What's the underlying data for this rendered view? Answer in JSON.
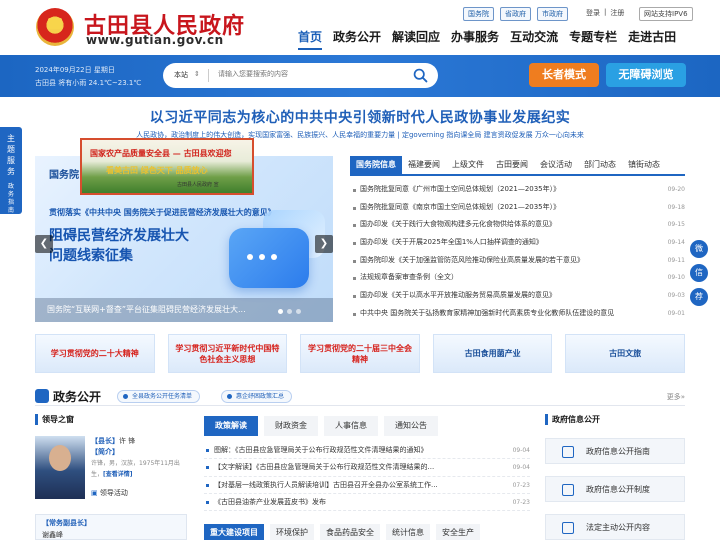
{
  "header": {
    "site_name": "古田县人民政府",
    "site_url": "www.gutian.gov.cn",
    "top_links": [
      "国务院",
      "省政府",
      "市政府"
    ],
    "login": "登录",
    "divider": "|",
    "register": "注册",
    "ipv6": "网站支持IPV6",
    "nav": [
      "首页",
      "政务公开",
      "解读回应",
      "办事服务",
      "互动交流",
      "专题专栏",
      "走进古田"
    ]
  },
  "band": {
    "date": "2024年09月22日 星期日",
    "weather": "古田县 将有小雨 24.1℃~23.1℃",
    "search_scope": "本站",
    "search_placeholder": "请输入您要搜索的内容",
    "elder_mode": "长者模式",
    "accessible": "无障碍浏览"
  },
  "side_float": {
    "label": "主题服务",
    "guide": "政务指南"
  },
  "slogan": {
    "title": "以习近平同志为核心的中共中央引领新时代人民政协事业发展纪实",
    "sub": "人民政协，政治制度上的伟大创造，实现国家富强、民族振兴、人民幸福的重要力量 | 定governing 指向课全局 建言资政促发展 万众一心向未来"
  },
  "promo": {
    "title": "国家农产品质量安全县 — 古田县欢迎您",
    "sub": "看美古田 绿色天下 品质放心",
    "foot": "古田县人民政府 宣"
  },
  "carousel": {
    "line1": "国务院",
    "line2": "贯彻落实《中共中央 国务院关于促进民营经济发展壮大的意见》",
    "line3a": "阻碍民营经济发展壮大",
    "line3b": "问题线索征集",
    "caption": "国务院“互联网+督查”平台征集阻碍民营经济发展壮大..."
  },
  "news": {
    "tabs": [
      "国务院信息",
      "福建要闻",
      "上级文件",
      "古田要闻",
      "会议活动",
      "部门动态",
      "镇街动态"
    ],
    "items": [
      {
        "title": "国务院批复同意《广州市国土空间总体规划（2021—2035年）》",
        "date": "09-20"
      },
      {
        "title": "国务院批复同意《南京市国土空间总体规划（2021—2035年）》",
        "date": "09-18"
      },
      {
        "title": "国办印发《关于践行大食物观构建多元化食物供给体系的意见》",
        "date": "09-15"
      },
      {
        "title": "国办印发《关于开展2025年全国1%人口抽样调查的通知》",
        "date": "09-14"
      },
      {
        "title": "国务院印发《关于加强监管防范风险推动保险业高质量发展的若干意见》",
        "date": "09-11"
      },
      {
        "title": "法规规章备案审查条例（全文）",
        "date": "09-10"
      },
      {
        "title": "国办印发《关于以高水平开放推动服务贸易高质量发展的意见》",
        "date": "09-03"
      },
      {
        "title": "中共中央 国务院关于弘扬教育家精神加强新时代高素质专业化教师队伍建设的意见",
        "date": "09-01"
      }
    ]
  },
  "right_float": [
    "微",
    "信",
    "荐"
  ],
  "banners": [
    "学习贯彻党的二十大精神",
    "学习贯彻习近平新时代中国特色社会主义思想",
    "学习贯彻党的二十届三中全会精神",
    "古田食用菌产业",
    "古田文旅"
  ],
  "section": {
    "title": "政务公开",
    "pill1": "全县政务公开任务清单",
    "pill2": "惠企纾困政策汇总",
    "more": "更多»"
  },
  "leader": {
    "head": "领导之窗",
    "title_label": "【县长】",
    "title_name": "许 锋",
    "intro_label": "【简介】",
    "intro": "许锋，男，汉族，1975年11月出生，",
    "detail": "[查看详情]",
    "activity": "领导活动",
    "deputy_label": "【常务副县长】",
    "deputy_name": "谢鑫峰"
  },
  "policy": {
    "tabs": [
      "政策解读",
      "财政资金",
      "人事信息",
      "通知公告"
    ],
    "items": [
      {
        "title": "图解：《古田县应急管理局关于公布行政规范性文件清理结果的通知》",
        "date": "09-04"
      },
      {
        "title": "【文字解读】《古田县应急管理局关于公布行政规范性文件清理结果的...",
        "date": "09-04"
      },
      {
        "title": "【对基层一线政策执行人员解读培训】古田县召开全县办公室系统工作...",
        "date": "07-23"
      },
      {
        "title": "《古田县油茶产业发展蓝皮书》发布",
        "date": "07-23"
      }
    ],
    "tabs2": [
      "重大建设项目",
      "环境保护",
      "食品药品安全",
      "统计信息",
      "安全生产"
    ]
  },
  "info": {
    "head": "政府信息公开",
    "items": [
      "政府信息公开指南",
      "政府信息公开制度",
      "法定主动公开内容"
    ]
  }
}
